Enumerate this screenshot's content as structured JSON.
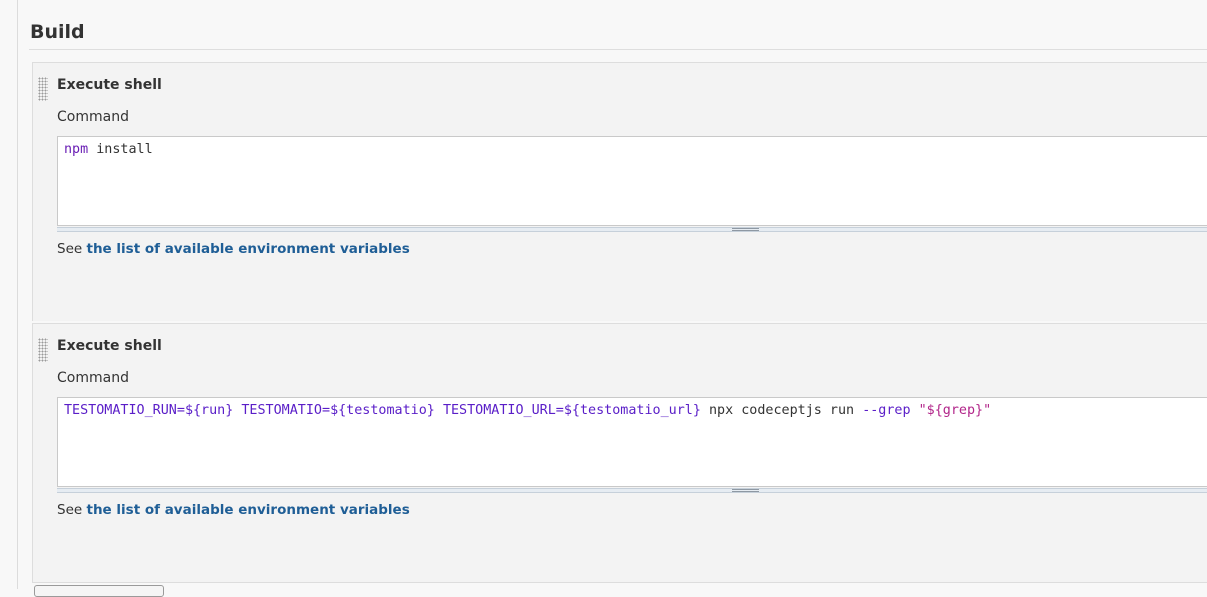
{
  "section": {
    "title": "Build"
  },
  "steps": [
    {
      "title": "Execute shell",
      "field_label": "Command",
      "command_tokens": [
        {
          "text": "npm",
          "kind": "cmd"
        },
        {
          "text": " install",
          "kind": "plain"
        }
      ],
      "help_prefix": "See ",
      "help_link": "the list of available environment variables"
    },
    {
      "title": "Execute shell",
      "field_label": "Command",
      "command_tokens": [
        {
          "text": "TESTOMATIO_RUN=",
          "kind": "var"
        },
        {
          "text": "${run}",
          "kind": "var"
        },
        {
          "text": " ",
          "kind": "plain"
        },
        {
          "text": "TESTOMATIO=",
          "kind": "var"
        },
        {
          "text": "${testomatio}",
          "kind": "var"
        },
        {
          "text": " ",
          "kind": "plain"
        },
        {
          "text": "TESTOMATIO_URL=",
          "kind": "var"
        },
        {
          "text": "${testomatio_url}",
          "kind": "var"
        },
        {
          "text": " npx codeceptjs run ",
          "kind": "plain"
        },
        {
          "text": "--grep",
          "kind": "var"
        },
        {
          "text": " ",
          "kind": "plain"
        },
        {
          "text": "\"${grep}\"",
          "kind": "str"
        }
      ],
      "help_prefix": "See ",
      "help_link": "the list of available environment variables"
    }
  ],
  "colors": {
    "link": "#1f5e96",
    "variable": "#5a1ec8",
    "string": "#b2268a"
  }
}
